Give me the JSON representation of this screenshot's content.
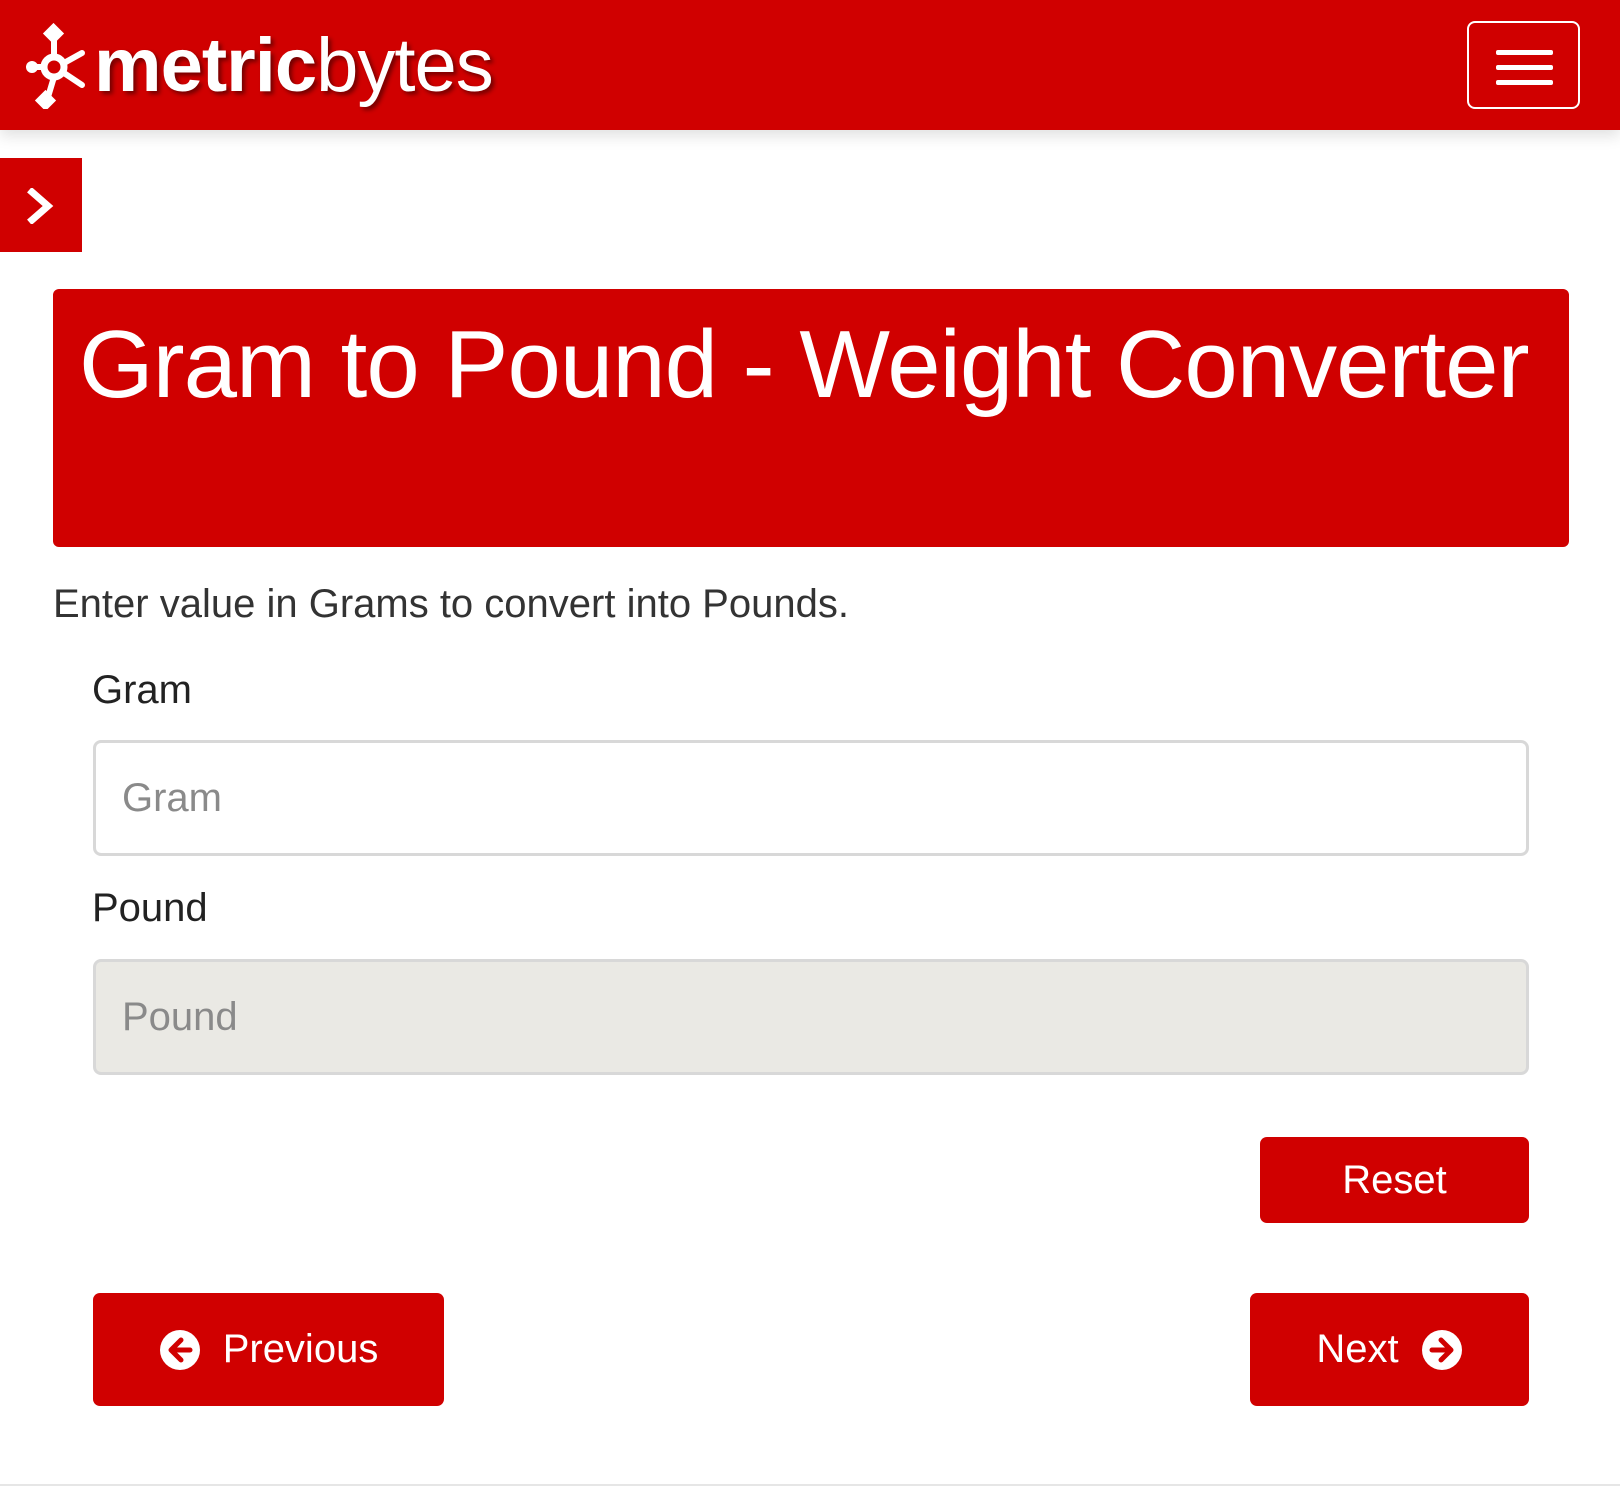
{
  "header": {
    "logo_text_bold": "metric",
    "logo_text_light": "bytes",
    "brand_color": "#d00000",
    "menu_icon": "hamburger-menu-icon"
  },
  "sidebar_toggle": {
    "icon": "chevron-right-icon"
  },
  "main": {
    "title": "Gram to Pound - Weight Converter",
    "intro": "Enter value in Grams to convert into Pounds.",
    "gram_field": {
      "label": "Gram",
      "placeholder": "Gram",
      "value": ""
    },
    "pound_field": {
      "label": "Pound",
      "placeholder": "Pound",
      "value": "",
      "readonly": true
    },
    "reset_label": "Reset",
    "previous_label": "Previous",
    "next_label": "Next",
    "previous_icon": "arrow-circle-left-icon",
    "next_icon": "arrow-circle-right-icon"
  }
}
